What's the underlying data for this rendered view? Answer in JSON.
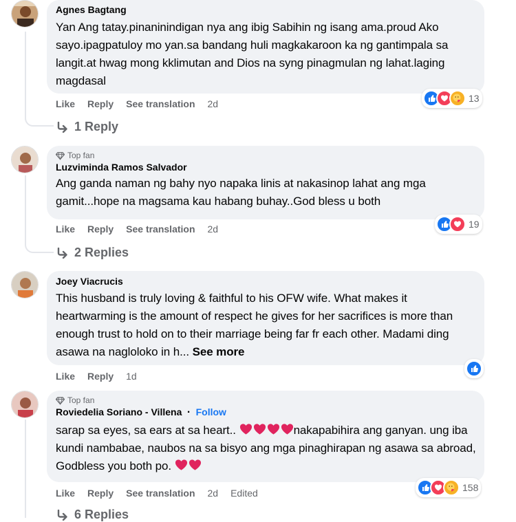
{
  "labels": {
    "like": "Like",
    "reply": "Reply",
    "see_translation": "See translation",
    "top_fan": "Top fan",
    "see_more": "See more",
    "follow": "Follow",
    "edited": "Edited"
  },
  "icons": {
    "reply_arrow": "reply-arrow-icon",
    "top_fan_badge": "diamond-icon",
    "like_reaction": "like-reaction-icon",
    "love_reaction": "love-reaction-icon",
    "care_reaction": "care-reaction-icon"
  },
  "colors": {
    "bubble": "#f0f2f5",
    "meta_text": "#65676b",
    "like_blue": "#1877f2",
    "love_red": "#f33e58",
    "care_yellow": "#f7b125"
  },
  "comments": [
    {
      "author": "Agnes Bagtang",
      "text": "Yan Ang tatay.pinaninindigan nya ang ibig Sabihin ng isang ama.proud Ako sayo.ipagpatuloy mo yan.sa bandang huli magkakaroon ka ng gantimpala sa langit.at hwag mong kklimutan and Dios na syng pinagmulan ng lahat.laging magdasal",
      "time": "2d",
      "reaction_count": "13",
      "replies": "1 Reply"
    },
    {
      "author": "Luzviminda Ramos Salvador",
      "text": "Ang ganda naman ng bahy nyo napaka linis at nakasinop lahat ang mga gamit...hope na magsama kau habang buhay..God bless u both",
      "time": "2d",
      "reaction_count": "19",
      "replies": "2 Replies"
    },
    {
      "author": "Joey Viacrucis",
      "text": "This husband is truly loving & faithful to his OFW wife. What makes it heartwarming is the amount of respect he gives for her sacrifices is more than enough trust to hold on to their marriage being far fr each other. Madami ding asawa na nagloloko in h...",
      "time": "1d"
    },
    {
      "author": "Roviedelia Soriano - Villena",
      "separator": "·",
      "text_a": "sarap sa eyes, sa ears at sa heart..",
      "text_b": "nakapabihira ang ganyan. ung iba kundi nambabae, naubos na sa bisyo ang mga pinaghirapan ng asawa sa abroad, Godbless you both po.",
      "time": "2d",
      "reaction_count": "158",
      "replies": "6 Replies"
    }
  ]
}
